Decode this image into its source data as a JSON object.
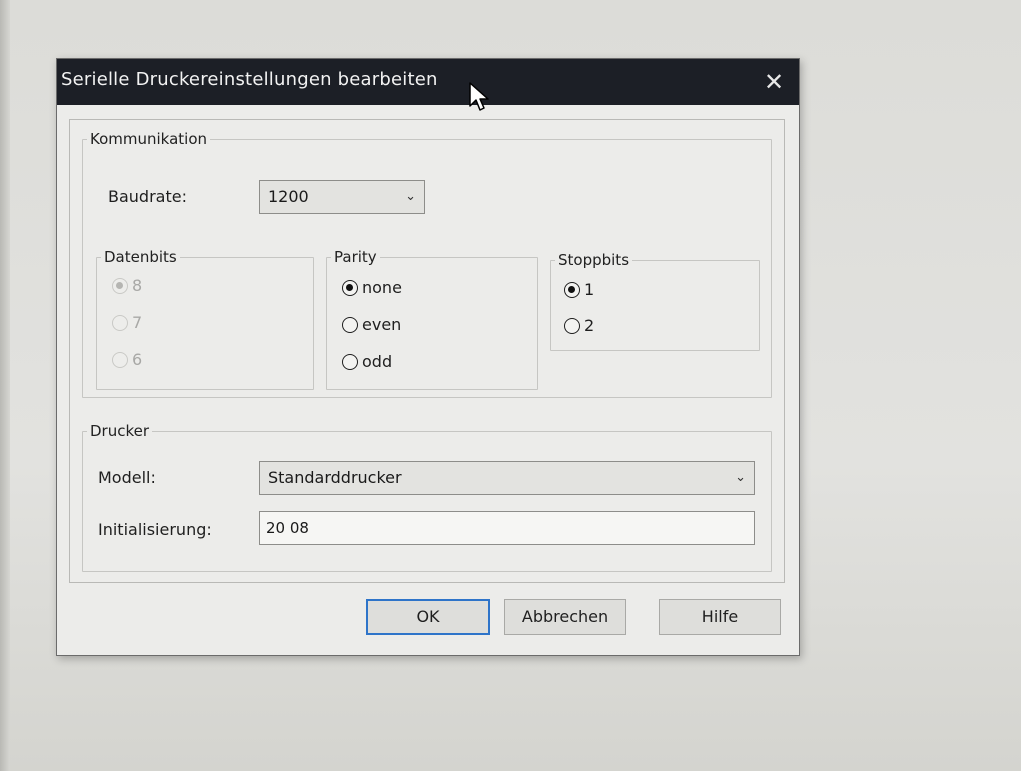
{
  "dialog": {
    "title": "Serielle Druckereinstellungen bearbeiten",
    "close_glyph": "✕"
  },
  "kommunikation": {
    "legend": "Kommunikation",
    "baudrate_label": "Baudrate:",
    "baudrate_value": "1200",
    "datenbits": {
      "legend": "Datenbits",
      "options": [
        "8",
        "7",
        "6"
      ],
      "selected": "8",
      "enabled": false
    },
    "parity": {
      "legend": "Parity",
      "options": [
        "none",
        "even",
        "odd"
      ],
      "selected": "none"
    },
    "stoppbits": {
      "legend": "Stoppbits",
      "options": [
        "1",
        "2"
      ],
      "selected": "1"
    }
  },
  "drucker": {
    "legend": "Drucker",
    "modell_label": "Modell:",
    "modell_value": "Standarddrucker",
    "init_label": "Initialisierung:",
    "init_value": "20 08"
  },
  "buttons": {
    "ok": "OK",
    "cancel": "Abbrechen",
    "help": "Hilfe"
  },
  "icons": {
    "chevron": "chevron-down-icon",
    "cursor": "mouse-pointer-icon",
    "close": "close-icon"
  }
}
